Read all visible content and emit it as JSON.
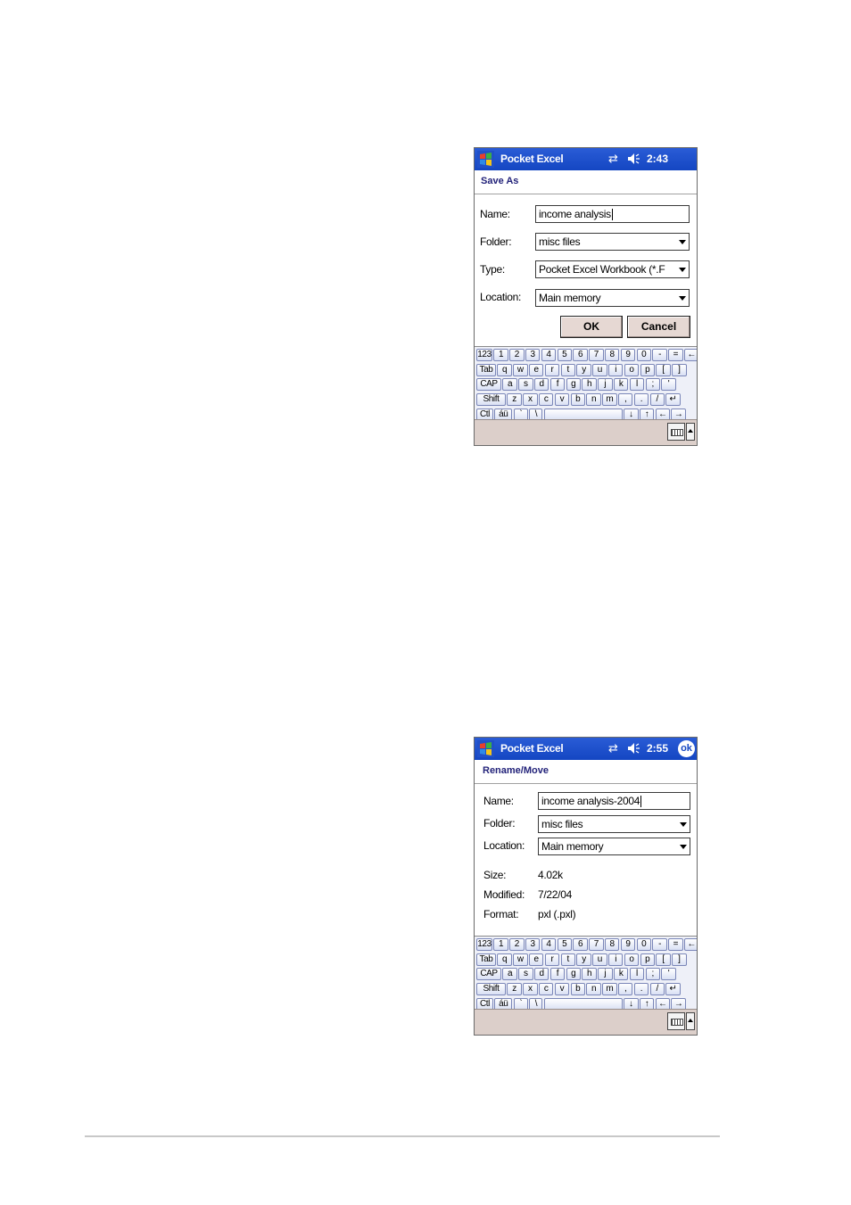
{
  "screen1": {
    "app_title": "Pocket Excel",
    "time": "2:43",
    "dialog_title": "Save As",
    "name_label": "Name:",
    "name_value": "income analysis",
    "folder_label": "Folder:",
    "folder_value": "misc files",
    "type_label": "Type:",
    "type_value": "Pocket Excel Workbook (*.F",
    "location_label": "Location:",
    "location_value": "Main memory",
    "ok_label": "OK",
    "cancel_label": "Cancel"
  },
  "screen2": {
    "app_title": "Pocket Excel",
    "time": "2:55",
    "ok_badge": "ok",
    "dialog_title": "Rename/Move",
    "name_label": "Name:",
    "name_value": "income analysis-2004",
    "folder_label": "Folder:",
    "folder_value": "misc files",
    "location_label": "Location:",
    "location_value": "Main memory",
    "size_label": "Size:",
    "size_value": "4.02k",
    "modified_label": "Modified:",
    "modified_value": "7/22/04",
    "format_label": "Format:",
    "format_value": "pxl (.pxl)"
  },
  "keyboard_rows": [
    [
      "123",
      "1",
      "2",
      "3",
      "4",
      "5",
      "6",
      "7",
      "8",
      "9",
      "0",
      "-",
      "=",
      "←"
    ],
    [
      "Tab",
      "q",
      "w",
      "e",
      "r",
      "t",
      "y",
      "u",
      "i",
      "o",
      "p",
      "[",
      "]"
    ],
    [
      "CAP",
      "a",
      "s",
      "d",
      "f",
      "g",
      "h",
      "j",
      "k",
      "l",
      ";",
      "'"
    ],
    [
      "Shift",
      "z",
      "x",
      "c",
      "v",
      "b",
      "n",
      "m",
      ",",
      ".",
      "/",
      "↵"
    ],
    [
      "Ctl",
      "áü",
      "`",
      "\\",
      " ",
      "↓",
      "↑",
      "←",
      "→"
    ]
  ],
  "icons": {
    "start": "windows-flag-icon",
    "sync": "sync-arrows-icon",
    "volume": "speaker-icon",
    "keyboard": "keyboard-icon",
    "sip_up": "up-arrow-icon"
  },
  "colors": {
    "titlebar": "#1446c2",
    "dialog_title": "#23237a",
    "button_face": "#e6d8d3",
    "bottom_bar": "#dccfca"
  }
}
